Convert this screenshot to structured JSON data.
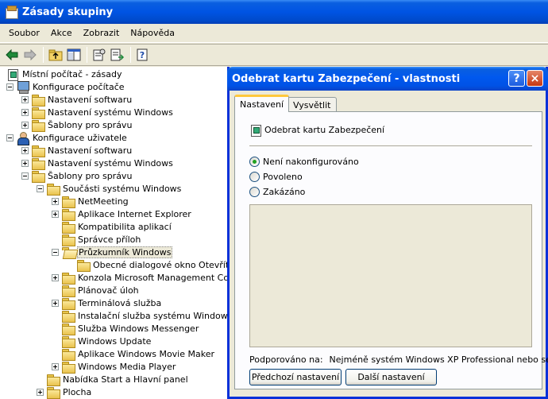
{
  "window": {
    "title": "Zásady skupiny"
  },
  "menu": [
    "Soubor",
    "Akce",
    "Zobrazit",
    "Nápověda"
  ],
  "toolbar": {
    "icons": [
      "back-arrow-icon",
      "forward-arrow-icon",
      "up-folder-icon",
      "show-hide-tree-icon",
      "properties-icon",
      "export-list-icon",
      "help-icon"
    ]
  },
  "tree": {
    "items": [
      {
        "label": "Místní počítač - zásady",
        "icon": "policy-icon",
        "level": 0,
        "expander": "none"
      },
      {
        "label": "Konfigurace počítače",
        "icon": "computer-icon",
        "level": 0,
        "expander": "minus"
      },
      {
        "label": "Nastavení softwaru",
        "icon": "folder-icon",
        "level": 1,
        "expander": "plus"
      },
      {
        "label": "Nastavení systému Windows",
        "icon": "folder-icon",
        "level": 1,
        "expander": "plus"
      },
      {
        "label": "Šablony pro správu",
        "icon": "folder-icon",
        "level": 1,
        "expander": "plus"
      },
      {
        "label": "Konfigurace uživatele",
        "icon": "user-icon",
        "level": 0,
        "expander": "minus"
      },
      {
        "label": "Nastavení softwaru",
        "icon": "folder-icon",
        "level": 1,
        "expander": "plus"
      },
      {
        "label": "Nastavení systému Windows",
        "icon": "folder-icon",
        "level": 1,
        "expander": "plus"
      },
      {
        "label": "Šablony pro správu",
        "icon": "folder-icon",
        "level": 1,
        "expander": "minus"
      },
      {
        "label": "Součásti systému Windows",
        "icon": "folder-icon",
        "level": 2,
        "expander": "minus"
      },
      {
        "label": "NetMeeting",
        "icon": "folder-icon",
        "level": 3,
        "expander": "plus"
      },
      {
        "label": "Aplikace Internet Explorer",
        "icon": "folder-icon",
        "level": 3,
        "expander": "plus"
      },
      {
        "label": "Kompatibilita aplikací",
        "icon": "folder-icon",
        "level": 3,
        "expander": "none"
      },
      {
        "label": "Správce příloh",
        "icon": "folder-icon",
        "level": 3,
        "expander": "none"
      },
      {
        "label": "Průzkumník Windows",
        "icon": "folder-open-icon",
        "level": 3,
        "expander": "minus",
        "selected": true
      },
      {
        "label": "Obecné dialogové okno Otevřít so",
        "icon": "folder-icon",
        "level": 4,
        "expander": "none"
      },
      {
        "label": "Konzola Microsoft Management Consol",
        "icon": "folder-icon",
        "level": 3,
        "expander": "plus"
      },
      {
        "label": "Plánovač úloh",
        "icon": "folder-icon",
        "level": 3,
        "expander": "none"
      },
      {
        "label": "Terminálová služba",
        "icon": "folder-icon",
        "level": 3,
        "expander": "plus"
      },
      {
        "label": "Instalační služba systému Windows",
        "icon": "folder-icon",
        "level": 3,
        "expander": "none"
      },
      {
        "label": "Služba Windows Messenger",
        "icon": "folder-icon",
        "level": 3,
        "expander": "none"
      },
      {
        "label": "Windows Update",
        "icon": "folder-icon",
        "level": 3,
        "expander": "none"
      },
      {
        "label": "Aplikace Windows Movie Maker",
        "icon": "folder-icon",
        "level": 3,
        "expander": "none"
      },
      {
        "label": "Windows Media Player",
        "icon": "folder-icon",
        "level": 3,
        "expander": "plus"
      },
      {
        "label": "Nabídka Start a Hlavní panel",
        "icon": "folder-icon",
        "level": 2,
        "expander": "none"
      },
      {
        "label": "Plocha",
        "icon": "folder-icon",
        "level": 2,
        "expander": "plus"
      }
    ]
  },
  "dialog": {
    "title": "Odebrat kartu Zabezpečení - vlastnosti",
    "help_label": "?",
    "close_label": "×",
    "tabs": [
      "Nastavení",
      "Vysvětlit"
    ],
    "policy_name": "Odebrat kartu Zabezpečení",
    "options": [
      {
        "label": "Není nakonfigurováno",
        "checked": true
      },
      {
        "label": "Povoleno",
        "checked": false
      },
      {
        "label": "Zakázáno",
        "checked": false
      }
    ],
    "supported_label": "Podporováno na:",
    "supported_value": "Nejméně systém Windows XP Professional nebo serve...",
    "prev_button": "Předchozí nastavení",
    "next_button": "Další nastavení"
  }
}
